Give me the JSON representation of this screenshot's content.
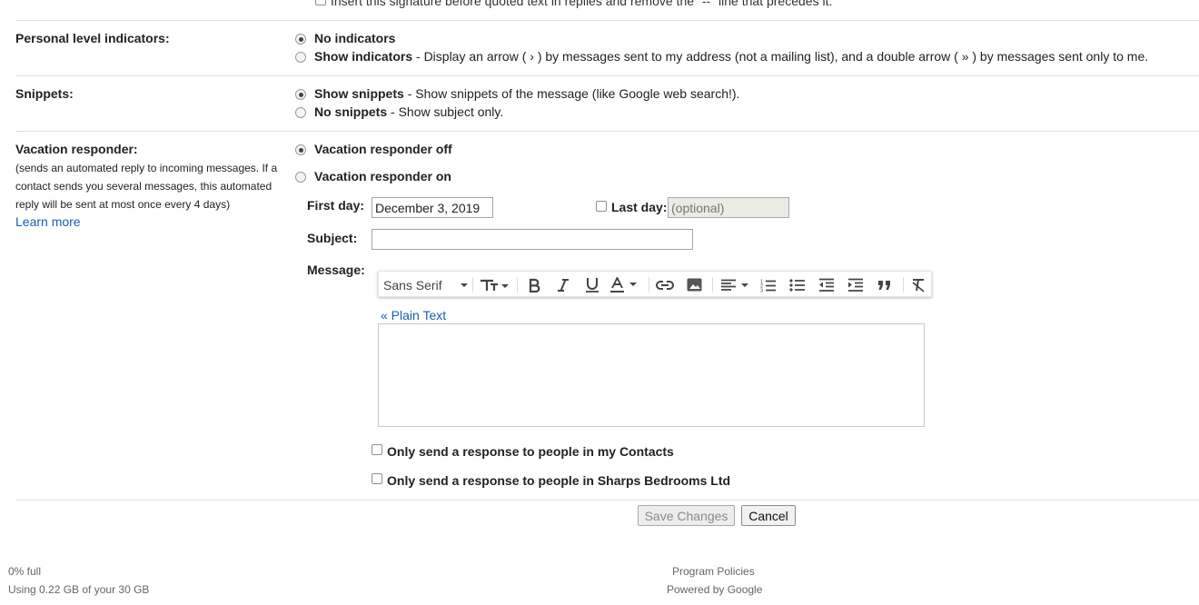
{
  "signature": {
    "insert_option": "Insert this signature before quoted text in replies and remove the \"--\" line that precedes it."
  },
  "personal_level": {
    "label": "Personal level indicators:",
    "options": [
      {
        "title": "No indicators",
        "desc": "",
        "selected": true
      },
      {
        "title": "Show indicators",
        "desc": "- Display an arrow ( › ) by messages sent to my address (not a mailing list), and a double arrow ( » ) by messages sent only to me.",
        "selected": false
      }
    ]
  },
  "snippets": {
    "label": "Snippets:",
    "options": [
      {
        "title": "Show snippets",
        "desc": "- Show snippets of the message (like Google web search!).",
        "selected": true
      },
      {
        "title": "No snippets",
        "desc": "- Show subject only.",
        "selected": false
      }
    ]
  },
  "vacation": {
    "label": "Vacation responder:",
    "description": "(sends an automated reply to incoming messages. If a contact sends you several messages, this automated reply will be sent at most once every 4 days)",
    "learn_more": "Learn more",
    "off_label": "Vacation responder off",
    "on_label": "Vacation responder on",
    "off_selected": true,
    "first_day_label": "First day:",
    "first_day_value": "December 3, 2019",
    "last_day_label": "Last day:",
    "last_day_placeholder": "(optional)",
    "subject_label": "Subject:",
    "subject_value": "",
    "message_label": "Message:",
    "plain_text_link": "« Plain Text",
    "contacts_only_label": "Only send a response to people in my Contacts",
    "domain_only_label": "Only send a response to people in Sharps Bedrooms Ltd"
  },
  "toolbar": {
    "font_name": "Sans Serif",
    "icons": [
      "font-size-icon",
      "bold-icon",
      "italic-icon",
      "underline-icon",
      "text-color-icon",
      "link-icon",
      "image-icon",
      "align-icon",
      "numbered-list-icon",
      "bulleted-list-icon",
      "indent-less-icon",
      "indent-more-icon",
      "quote-icon",
      "remove-formatting-icon"
    ]
  },
  "actions": {
    "save_label": "Save Changes",
    "cancel_label": "Cancel"
  },
  "footer": {
    "usage_percent": "0% full",
    "usage_detail": "Using 0.22 GB of your 30 GB",
    "program_policies": "Program Policies",
    "powered_by": "Powered by Google"
  },
  "colors": {
    "link": "#1a5eb5",
    "divider": "#e0e0e0",
    "text": "#222222"
  }
}
